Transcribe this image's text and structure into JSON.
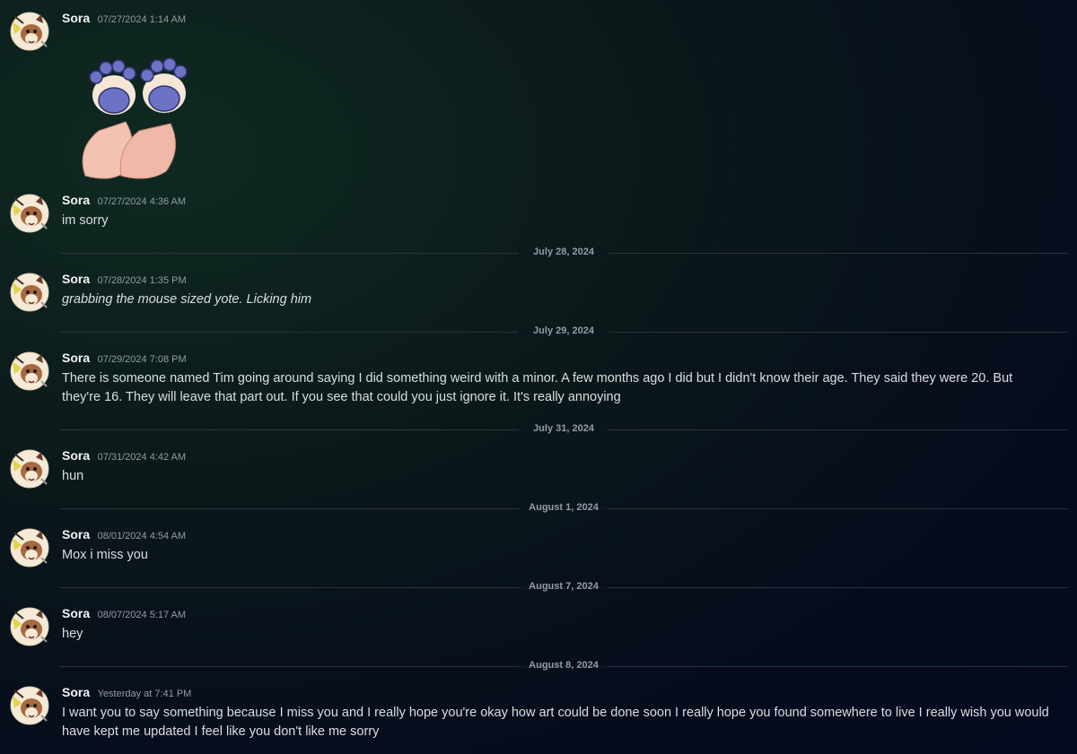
{
  "messages": [
    {
      "author": "Sora",
      "timestamp": "07/27/2024 1:14 AM",
      "text": "",
      "has_sticker": true
    },
    {
      "author": "Sora",
      "timestamp": "07/27/2024 4:36 AM",
      "text": "im sorry"
    },
    {
      "author": "Sora",
      "timestamp": "07/28/2024 1:35 PM",
      "text": "grabbing the mouse sized yote. Licking him"
    },
    {
      "author": "Sora",
      "timestamp": "07/29/2024 7:08 PM",
      "text": "There is someone named Tim going around saying I did something weird with a minor. A few months ago I did but I didn't know their age. They said they were 20. But they're 16. They will leave that part out. If you see that could you just ignore it. It's really annoying"
    },
    {
      "author": "Sora",
      "timestamp": "07/31/2024 4:42 AM",
      "text": "hun"
    },
    {
      "author": "Sora",
      "timestamp": "08/01/2024 4:54 AM",
      "text": "Mox i miss you"
    },
    {
      "author": "Sora",
      "timestamp": "08/07/2024 5:17 AM",
      "text": "hey"
    },
    {
      "author": "Sora",
      "timestamp": "Yesterday at 7:41 PM",
      "text": "I want you to say something because I miss you and I really hope you're okay how art could be done soon I really hope you found somewhere to live I really wish you would have kept me updated I feel like you don't like me sorry"
    }
  ],
  "dividers": [
    "July 28, 2024",
    "July 29, 2024",
    "July 31, 2024",
    "August 1, 2024",
    "August 7, 2024",
    "August 8, 2024"
  ],
  "colors": {
    "background": "#070d1c",
    "author": "#f2f3f5",
    "timestamp": "#949ba4",
    "text": "#dbdee1",
    "divider": "#2a3338",
    "sticker_pads": "#6c72c4",
    "sticker_skin": "#f3c2b3"
  },
  "icons": [
    "avatar",
    "paw-feet-sticker"
  ]
}
